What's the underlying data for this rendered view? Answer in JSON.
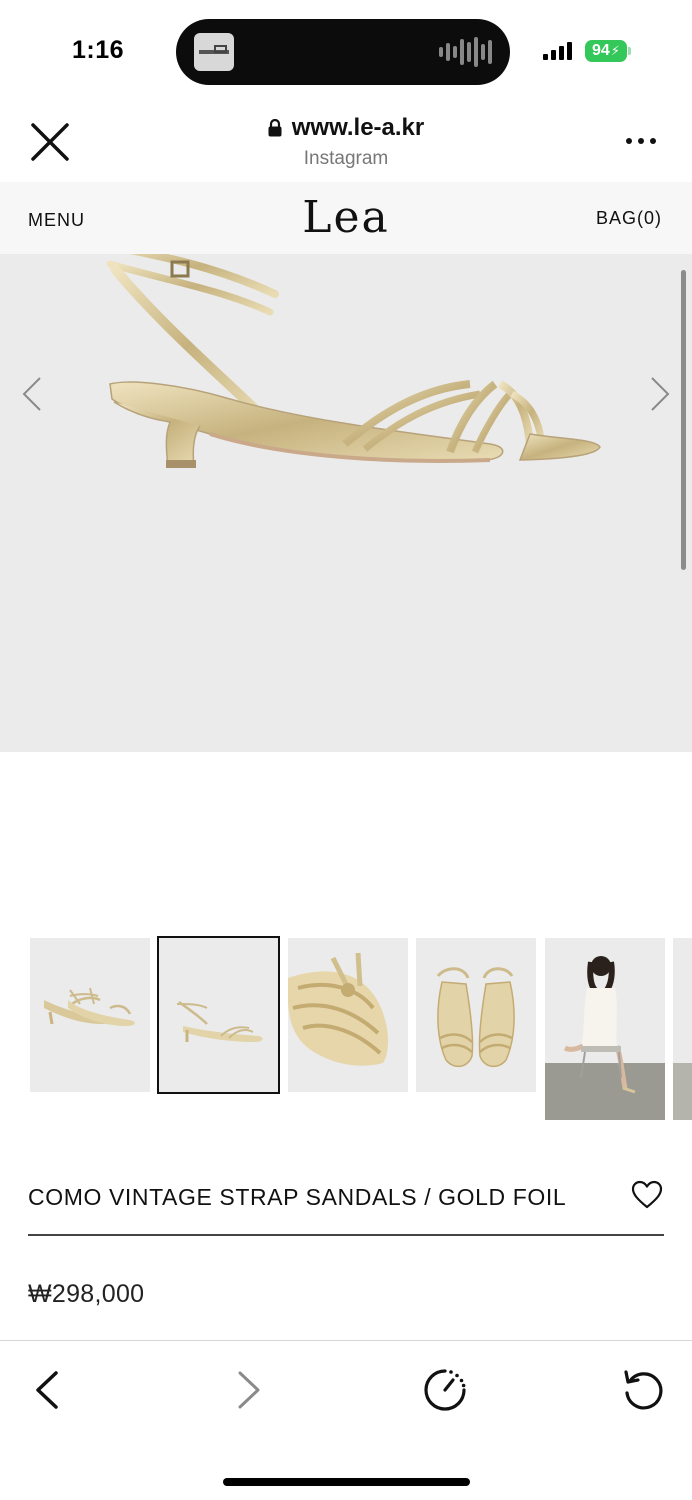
{
  "status_bar": {
    "time": "1:16",
    "battery": "94"
  },
  "browser": {
    "url": "www.le-a.kr",
    "subtitle": "Instagram"
  },
  "site_nav": {
    "menu_label": "MENU",
    "logo": "Lea",
    "bag_label": "BAG(0)"
  },
  "product": {
    "title": "COMO VINTAGE STRAP SANDALS / GOLD FOIL",
    "price": "₩298,000",
    "selected_thumbnail": 2,
    "thumbnail_count": 6
  },
  "icons": {
    "close": "close-icon",
    "lock": "lock-icon",
    "more": "more-icon",
    "heart": "heart-icon",
    "back": "chevron-left-icon",
    "forward": "chevron-right-icon",
    "history": "timer-icon",
    "reload": "reload-icon"
  },
  "colors": {
    "battery": "#34c759",
    "image_bg": "#ebebeb",
    "gold": "#cfbf94"
  }
}
